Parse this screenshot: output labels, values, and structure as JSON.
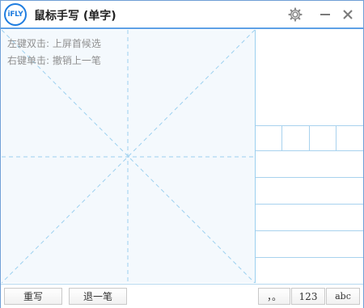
{
  "window": {
    "logo_text": "iFLY",
    "title": "鼠标手写 (单字)",
    "icons": [
      "settings-icon",
      "minimize-icon",
      "close-icon"
    ]
  },
  "pad": {
    "hint_line1": "左键双击: 上屏首候选",
    "hint_line2": "右键单击: 撤销上一笔"
  },
  "toolbar": {
    "rewrite_label": "重写",
    "undo_label": "退一笔",
    "punctuation_label": "，。",
    "numbers_label": "123",
    "letters_label": "abc"
  },
  "colors": {
    "accent": "#1f7de0",
    "pad_background": "#f4f9fd",
    "guide_lines": "#9cd0ef"
  }
}
